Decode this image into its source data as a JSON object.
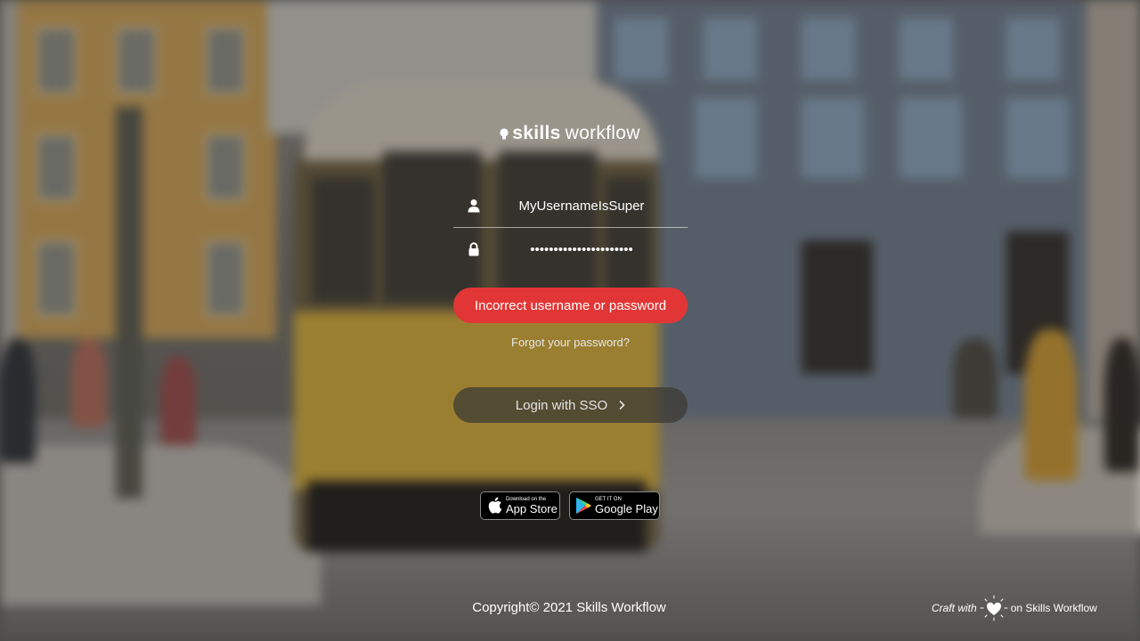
{
  "brand": {
    "word1": "skills",
    "word2": "workflow"
  },
  "login": {
    "username_value": "MyUsernameIsSuper",
    "password_value": "••••••••••••••••••••••",
    "error_message": "Incorrect username or password",
    "forgot_link": "Forgot your password?",
    "sso_label": "Login with SSO"
  },
  "stores": {
    "apple_small": "Download on the",
    "apple_big": "App Store",
    "google_small": "GET IT ON",
    "google_big": "Google Play"
  },
  "footer": {
    "copyright": "Copyright© 2021 Skills Workflow",
    "craft_prefix": "Craft with",
    "craft_suffix": "on Skills Workflow"
  },
  "colors": {
    "error": "#e23636",
    "sso_bg": "#3c3a34"
  },
  "icons": {
    "brand": "lightbulb-icon",
    "username": "user-icon",
    "password": "lock-icon",
    "sso": "chevron-right-icon",
    "apple": "apple-icon",
    "google": "google-play-icon",
    "heart": "heart-icon"
  }
}
